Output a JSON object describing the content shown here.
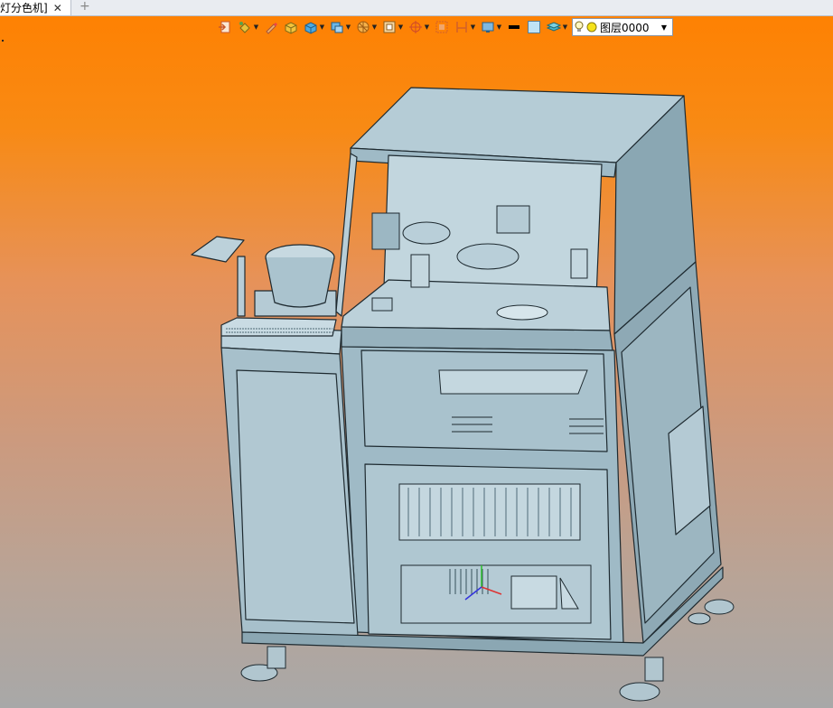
{
  "tab": {
    "title": "灯分色机]",
    "close": "✕",
    "add": "+"
  },
  "toolbar": {
    "layer": {
      "label": "图层0000"
    }
  },
  "colors": {
    "machine_face": "#a9c3cf",
    "machine_dark": "#7f9aa6",
    "edge": "#1e2a30",
    "bg_top": "#ff8000",
    "bg_bottom": "#a8a8a8"
  },
  "viewport": {
    "model": "machine-3d-model"
  }
}
